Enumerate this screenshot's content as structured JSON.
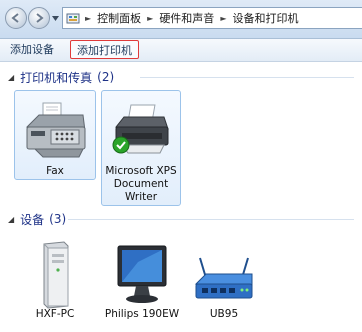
{
  "address_bar": {
    "breadcrumbs": [
      "控制面板",
      "硬件和声音",
      "设备和打印机"
    ]
  },
  "toolbar": {
    "add_device_label": "添加设备",
    "add_printer_label": "添加打印机"
  },
  "sections": {
    "printers": {
      "title": "打印机和传真",
      "count": "(2)",
      "items": [
        {
          "label": "Fax",
          "icon": "fax-icon"
        },
        {
          "label_lines": [
            "Microsoft XPS",
            "Document",
            "Writer"
          ],
          "icon": "printer-icon",
          "default": true
        }
      ]
    },
    "devices": {
      "title": "设备",
      "count": "(3)",
      "items": [
        {
          "label": "HXF-PC",
          "icon": "computer-tower-icon"
        },
        {
          "label": "Philips 190EW",
          "icon": "monitor-icon"
        },
        {
          "label": "UB95",
          "icon": "router-icon"
        }
      ]
    }
  },
  "colors": {
    "section_title": "#1e3287",
    "selection_border": "#9cc3ea",
    "highlight_box": "#e03a3a",
    "default_check": "#2aa52a"
  }
}
